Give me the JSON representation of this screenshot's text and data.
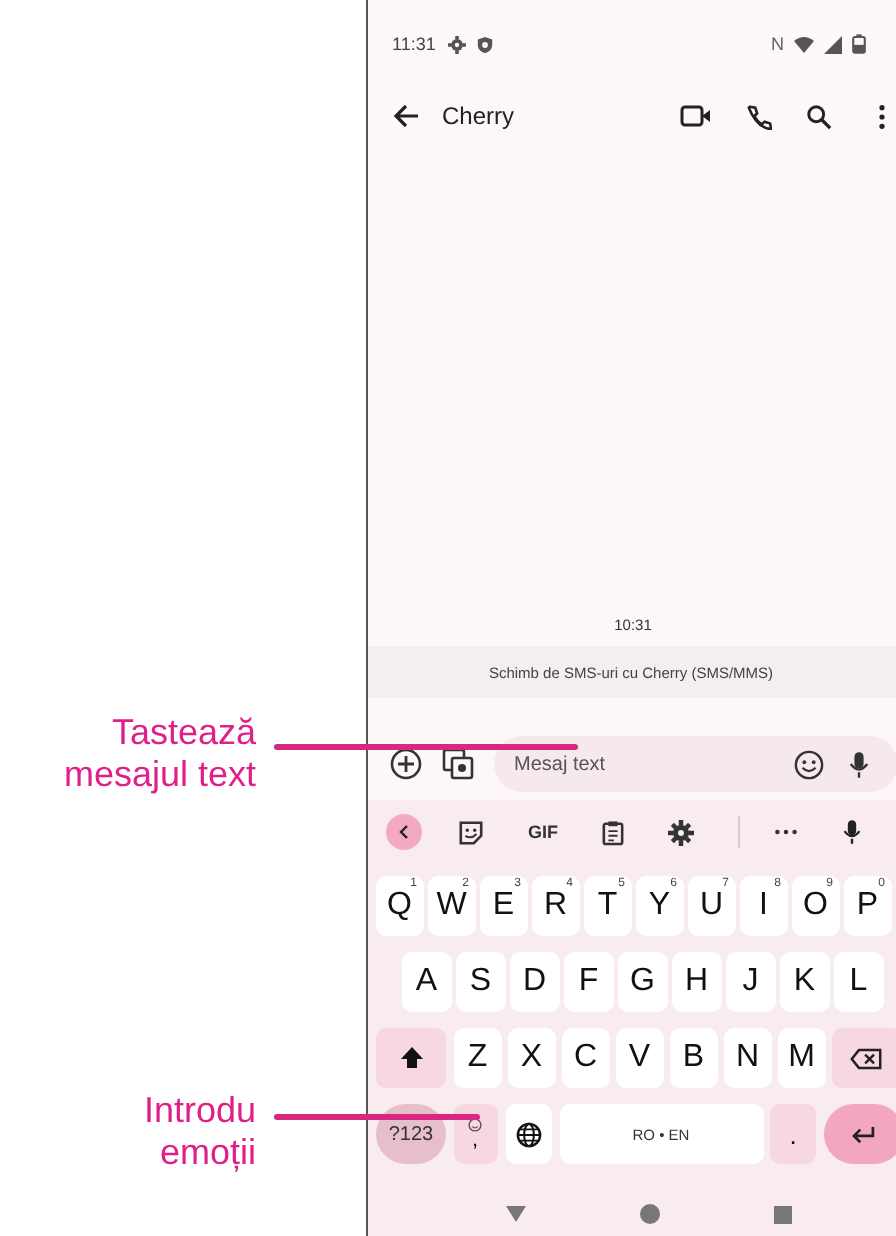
{
  "callouts": [
    {
      "text": "Tastează\nmesajul text"
    },
    {
      "text": "Introdu\nemoții"
    }
  ],
  "status_bar": {
    "time": "11:31",
    "network": "N"
  },
  "app_bar": {
    "title": "Cherry"
  },
  "conversation": {
    "timestamp": "10:31",
    "banner": "Schimb de SMS-uri cu Cherry (SMS/MMS)"
  },
  "compose": {
    "placeholder": "Mesaj text"
  },
  "keyboard": {
    "toolbar": {
      "gif": "GIF"
    },
    "rows": [
      [
        {
          "kind": "letter",
          "label": "Q",
          "hint": "1"
        },
        {
          "kind": "letter",
          "label": "W",
          "hint": "2"
        },
        {
          "kind": "letter",
          "label": "E",
          "hint": "3"
        },
        {
          "kind": "letter",
          "label": "R",
          "hint": "4"
        },
        {
          "kind": "letter",
          "label": "T",
          "hint": "5"
        },
        {
          "kind": "letter",
          "label": "Y",
          "hint": "6"
        },
        {
          "kind": "letter",
          "label": "U",
          "hint": "7"
        },
        {
          "kind": "letter",
          "label": "I",
          "hint": "8"
        },
        {
          "kind": "letter",
          "label": "O",
          "hint": "9"
        },
        {
          "kind": "letter",
          "label": "P",
          "hint": "0"
        }
      ],
      [
        {
          "kind": "letter",
          "label": "A"
        },
        {
          "kind": "letter",
          "label": "S"
        },
        {
          "kind": "letter",
          "label": "D"
        },
        {
          "kind": "letter",
          "label": "F"
        },
        {
          "kind": "letter",
          "label": "G"
        },
        {
          "kind": "letter",
          "label": "H"
        },
        {
          "kind": "letter",
          "label": "J"
        },
        {
          "kind": "letter",
          "label": "K"
        },
        {
          "kind": "letter",
          "label": "L"
        }
      ],
      [
        {
          "kind": "shift"
        },
        {
          "kind": "letter",
          "label": "Z"
        },
        {
          "kind": "letter",
          "label": "X"
        },
        {
          "kind": "letter",
          "label": "C"
        },
        {
          "kind": "letter",
          "label": "V"
        },
        {
          "kind": "letter",
          "label": "B"
        },
        {
          "kind": "letter",
          "label": "N"
        },
        {
          "kind": "letter",
          "label": "M"
        },
        {
          "kind": "backspace"
        }
      ]
    ],
    "bottom_row": [
      {
        "kind": "symbols",
        "label": "?123"
      },
      {
        "kind": "emoji",
        "label": ","
      },
      {
        "kind": "globe"
      },
      {
        "kind": "space",
        "label": "RO • EN"
      },
      {
        "kind": "period",
        "label": "."
      },
      {
        "kind": "enter"
      }
    ]
  }
}
